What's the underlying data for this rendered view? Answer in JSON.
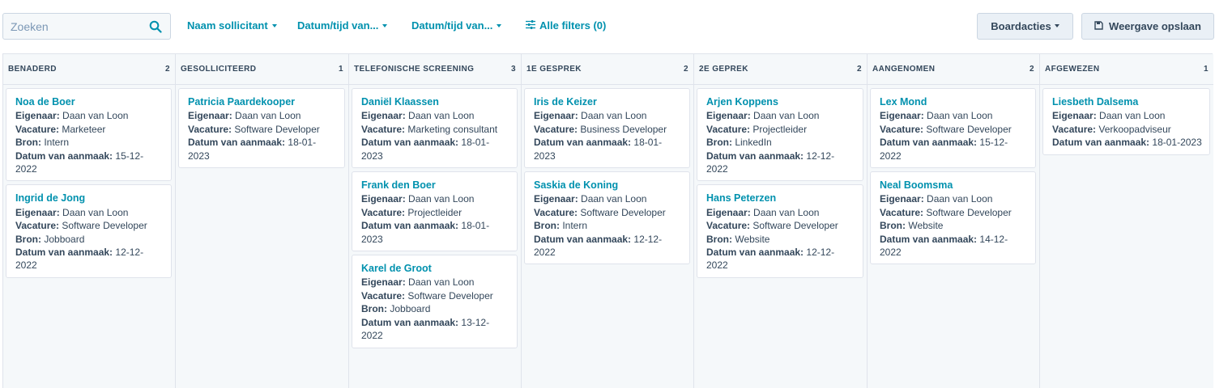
{
  "toolbar": {
    "search_placeholder": "Zoeken",
    "search_value": "",
    "filter_applicant": "Naam sollicitant",
    "filter_date_1": "Datum/tijd van...",
    "filter_date_2": "Datum/tijd van...",
    "filter_all": "Alle filters (0)",
    "board_actions": "Boardacties",
    "save_view": "Weergave opslaan"
  },
  "labels": {
    "owner": "Eigenaar:",
    "vacancy": "Vacature:",
    "source": "Bron:",
    "created": "Datum van aanmaak:"
  },
  "colors": {
    "accent": "#0091ae",
    "text": "#33475b",
    "border": "#dfe3eb",
    "column_bg": "#f5f8fa"
  },
  "columns": [
    {
      "title": "BENADERD",
      "count": "2",
      "cards": [
        {
          "name": "Noa de Boer",
          "owner": "Daan van Loon",
          "vacancy": "Marketeer",
          "source": "Intern",
          "created": "15-12-2022"
        },
        {
          "name": "Ingrid de Jong",
          "owner": "Daan van Loon",
          "vacancy": "Software Developer",
          "source": "Jobboard",
          "created": "12-12-2022"
        }
      ]
    },
    {
      "title": "GESOLLICITEERD",
      "count": "1",
      "cards": [
        {
          "name": "Patricia Paardekooper",
          "owner": "Daan van Loon",
          "vacancy": "Software Developer",
          "created": "18-01-2023"
        }
      ]
    },
    {
      "title": "TELEFONISCHE SCREENING",
      "count": "3",
      "cards": [
        {
          "name": "Daniël Klaassen",
          "owner": "Daan van Loon",
          "vacancy": "Marketing consultant",
          "created": "18-01-2023"
        },
        {
          "name": "Frank den Boer",
          "owner": "Daan van Loon",
          "vacancy": "Projectleider",
          "created": "18-01-2023"
        },
        {
          "name": "Karel de Groot",
          "owner": "Daan van Loon",
          "vacancy": "Software Developer",
          "source": "Jobboard",
          "created": "13-12-2022"
        }
      ]
    },
    {
      "title": "1E GESPREK",
      "count": "2",
      "cards": [
        {
          "name": "Iris de Keizer",
          "owner": "Daan van Loon",
          "vacancy": "Business Developer",
          "created": "18-01-2023"
        },
        {
          "name": "Saskia de Koning",
          "owner": "Daan van Loon",
          "vacancy": "Software Developer",
          "source": "Intern",
          "created": "12-12-2022"
        }
      ]
    },
    {
      "title": "2E GEPREK",
      "count": "2",
      "cards": [
        {
          "name": "Arjen Koppens",
          "owner": "Daan van Loon",
          "vacancy": "Projectleider",
          "source": "LinkedIn",
          "created": "12-12-2022"
        },
        {
          "name": "Hans Peterzen",
          "owner": "Daan van Loon",
          "vacancy": "Software Developer",
          "source": "Website",
          "created": "12-12-2022"
        }
      ]
    },
    {
      "title": "AANGENOMEN",
      "count": "2",
      "cards": [
        {
          "name": "Lex Mond",
          "owner": "Daan van Loon",
          "vacancy": "Software Developer",
          "created": "15-12-2022"
        },
        {
          "name": "Neal Boomsma",
          "owner": "Daan van Loon",
          "vacancy": "Software Developer",
          "source": "Website",
          "created": "14-12-2022"
        }
      ]
    },
    {
      "title": "AFGEWEZEN",
      "count": "1",
      "cards": [
        {
          "name": "Liesbeth Dalsema",
          "owner": "Daan van Loon",
          "vacancy": "Verkoopadviseur",
          "created": "18-01-2023"
        }
      ]
    }
  ]
}
